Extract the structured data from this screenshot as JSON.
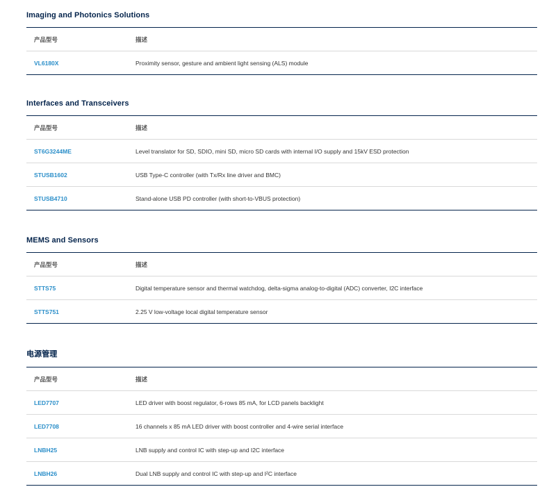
{
  "columns": {
    "part": "产品型号",
    "description": "描述"
  },
  "sections": [
    {
      "title": "Imaging and Photonics Solutions",
      "rows": [
        {
          "part": "VL6180X",
          "description": "Proximity sensor, gesture and ambient light sensing (ALS) module"
        }
      ]
    },
    {
      "title": "Interfaces and Transceivers",
      "rows": [
        {
          "part": "ST6G3244ME",
          "description": "Level translator for SD, SDIO, mini SD, micro SD cards with internal I/O supply and 15kV ESD protection"
        },
        {
          "part": "STUSB1602",
          "description": "USB Type-C controller (with Tx/Rx line driver and BMC)"
        },
        {
          "part": "STUSB4710",
          "description": "Stand-alone USB PD controller (with short-to-VBUS protection)"
        }
      ]
    },
    {
      "title": "MEMS and Sensors",
      "rows": [
        {
          "part": "STTS75",
          "description": "Digital temperature sensor and thermal watchdog, delta-sigma analog-to-digital (ADC) converter, I2C interface"
        },
        {
          "part": "STTS751",
          "description": "2.25 V low-voltage local digital temperature sensor"
        }
      ]
    },
    {
      "title": "电源管理",
      "rows": [
        {
          "part": "LED7707",
          "description": "LED driver with boost regulator, 6-rows 85 mA, for LCD panels backlight"
        },
        {
          "part": "LED7708",
          "description": "16 channels x 85 mA LED driver with boost controller and 4-wire serial interface"
        },
        {
          "part": "LNBH25",
          "description": "LNB supply and control IC with step-up and I2C interface"
        },
        {
          "part": "LNBH26",
          "description": "Dual LNB supply and control IC with step-up and I²C interface"
        }
      ]
    }
  ]
}
